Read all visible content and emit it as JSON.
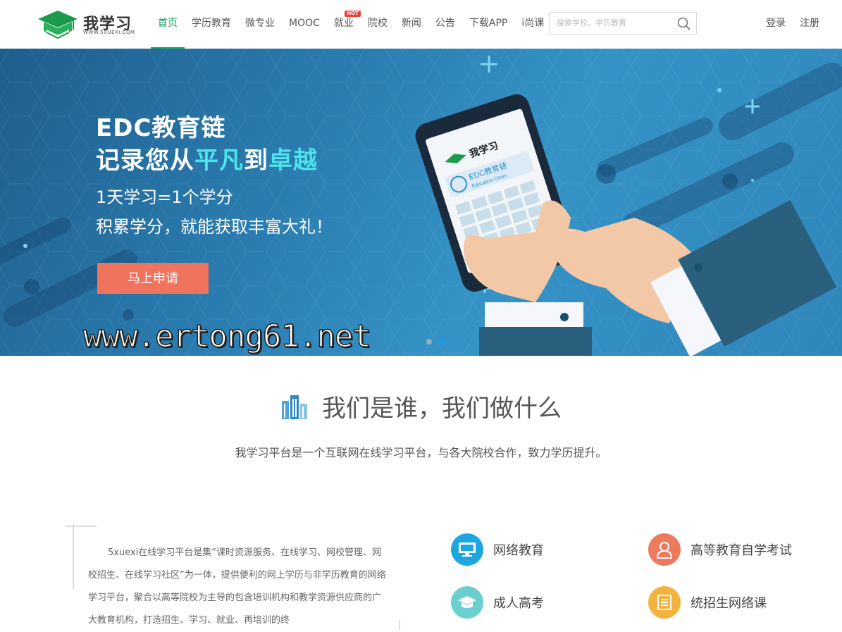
{
  "header": {
    "logo_text": "我学习",
    "logo_sub": "WWW.5XUEXI.COM",
    "nav": [
      {
        "label": "首页",
        "active": true
      },
      {
        "label": "学历教育"
      },
      {
        "label": "微专业"
      },
      {
        "label": "MOOC"
      },
      {
        "label": "就业",
        "badge": "HOT"
      },
      {
        "label": "院校"
      },
      {
        "label": "新闻"
      },
      {
        "label": "公告"
      },
      {
        "label": "下载APP"
      },
      {
        "label": "i尚课"
      }
    ],
    "search_placeholder": "搜索学校、学历教育",
    "login": "登录",
    "register": "注册"
  },
  "banner": {
    "title1": "EDC教育链",
    "title2_a": "记录您从",
    "title2_b": "平凡",
    "title2_c": "到",
    "title2_d": "卓越",
    "sub1": "1天学习=1个学分",
    "sub2": "积累学分，就能获取丰富大礼！",
    "cta": "马上申请",
    "phone_logo": "我学习",
    "phone_edc": "EDC教育链",
    "phone_edc_en": "Education Chain",
    "watermark": "www.ertong61.net",
    "slide_count": 2,
    "active_slide": 2
  },
  "about": {
    "title": "我们是谁，我们做什么",
    "desc": "我学习平台是一个互联网在线学习平台，与各大院校合作，致力学历提升。",
    "intro": "5xuexi在线学习平台是集“课时资源服务、在线学习、网校管理、网校招生、在线学习社区”为一体，提供便利的网上学历与非学历教育的网络学习平台，聚合以高等院校为主导的包含培训机构和教学资源供应商的广大教育机构，打造招生、学习、就业、再培训的终",
    "features": [
      {
        "label": "网络教育",
        "icon": "monitor-icon",
        "color": "#1ea6e0"
      },
      {
        "label": "高等教育自学考试",
        "icon": "person-icon",
        "color": "#ec7a5c"
      },
      {
        "label": "成人高考",
        "icon": "graduation-cap-icon",
        "color": "#6ccfcf"
      },
      {
        "label": "统招生网络课",
        "icon": "document-icon",
        "color": "#f3b33e"
      }
    ]
  }
}
